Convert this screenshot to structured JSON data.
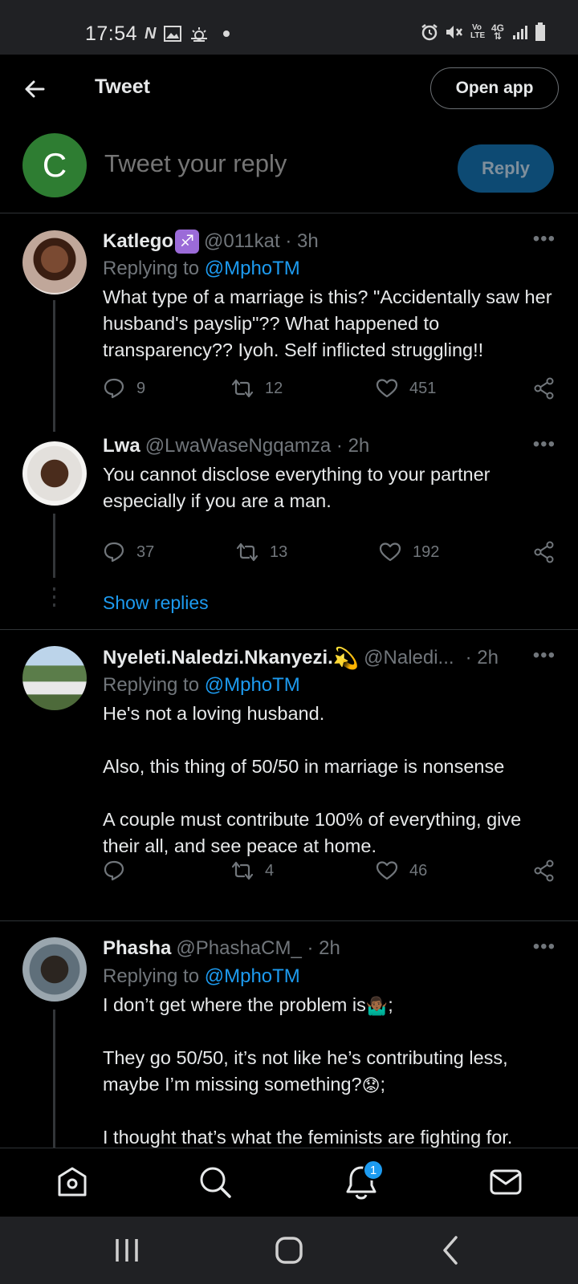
{
  "status_bar": {
    "time": "17:54",
    "left_icons": [
      "n-icon",
      "image-icon",
      "weather-icon",
      "dot-icon"
    ],
    "network": "4G",
    "volte": "Vo LTE"
  },
  "header": {
    "title": "Tweet",
    "open_app_label": "Open app"
  },
  "compose": {
    "avatar_letter": "C",
    "placeholder": "Tweet your reply",
    "reply_label": "Reply",
    "avatar_color": "#2e7d32"
  },
  "tweets": [
    {
      "name": "Katlego",
      "name_emoji": "♐",
      "handle": "@011kat · 3h",
      "replying_prefix": "Replying to ",
      "replying_to": "@MphoTM",
      "body": "What type of a marriage is this? \"Accidentally saw her husband's payslip\"?? What happened to transparency?? Iyoh. Self inflicted struggling!!",
      "replies": "9",
      "retweets": "12",
      "likes": "451"
    },
    {
      "name": "Lwa",
      "handle": "@LwaWaseNgqamza · 2h",
      "body": "You cannot disclose everything to your partner especially if you are a man.",
      "replies": "37",
      "retweets": "13",
      "likes": "192",
      "show_replies": "Show replies"
    },
    {
      "name": "Nyeleti.Naledzi.Nkanyezi.",
      "name_emoji": "💫",
      "handle": "@Naledi...",
      "time": "· 2h",
      "replying_prefix": "Replying to ",
      "replying_to": "@MphoTM",
      "body": "He's not a loving husband.\n\nAlso, this thing of 50/50 in marriage is nonsense\n\nA couple must contribute 100% of everything, give their all, and see peace at home.",
      "replies": "",
      "retweets": "4",
      "likes": "46"
    },
    {
      "name": "Phasha",
      "handle": "@PhashaCM_ · 2h",
      "replying_prefix": "Replying to ",
      "replying_to": "@MphoTM",
      "body_line1": "I don’t get where the problem is",
      "emoji1": "🤷🏾‍♂️",
      "suffix1": ";",
      "body_line2": "They go 50/50, it’s not like he’s contributing less, maybe I’m missing something?",
      "emoji2": "😟",
      "suffix2": ";",
      "body_line3": "I thought that’s what the feminists are fighting for."
    }
  ],
  "more_label": "•••",
  "bottom_nav": {
    "items": [
      "home-icon",
      "search-icon",
      "notifications-icon",
      "messages-icon"
    ],
    "notification_count": "1"
  },
  "colors": {
    "background": "#000000",
    "accent": "#1d9bf0",
    "muted": "#71767b"
  }
}
